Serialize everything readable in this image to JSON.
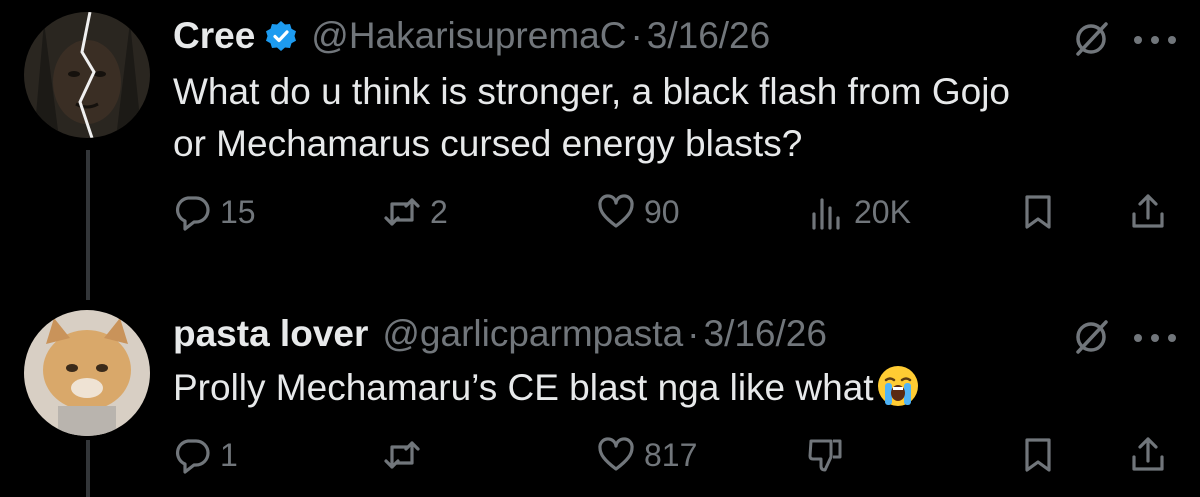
{
  "tweets": [
    {
      "author": {
        "name": "Cree",
        "handle": "@HakarisupremaC",
        "verified": true
      },
      "separator": "·",
      "date": "3/16/26",
      "text_lines": [
        "What do u think is stronger, a black flash from Gojo",
        "or Mechamarus cursed energy blasts?"
      ],
      "actions": {
        "replies": "15",
        "reposts": "2",
        "likes": "90",
        "views": "20K"
      }
    },
    {
      "author": {
        "name": "pasta lover",
        "handle": "@garlicparmpasta",
        "verified": false
      },
      "separator": "·",
      "date": "3/16/26",
      "text": "Prolly Mechamaru’s CE blast nga like what",
      "emoji": "loudly-crying-face",
      "actions": {
        "replies": "1",
        "reposts": "",
        "likes": "817"
      }
    }
  ],
  "colors": {
    "background": "#000000",
    "text": "#e7e9ea",
    "muted": "#71767b",
    "verified": "#1d9bf0",
    "thread_line": "#333639"
  },
  "icons": [
    "verified-badge-icon",
    "grok-icon",
    "more-icon",
    "reply-icon",
    "repost-icon",
    "like-icon",
    "views-icon",
    "bookmark-icon",
    "share-icon",
    "dislike-icon"
  ]
}
